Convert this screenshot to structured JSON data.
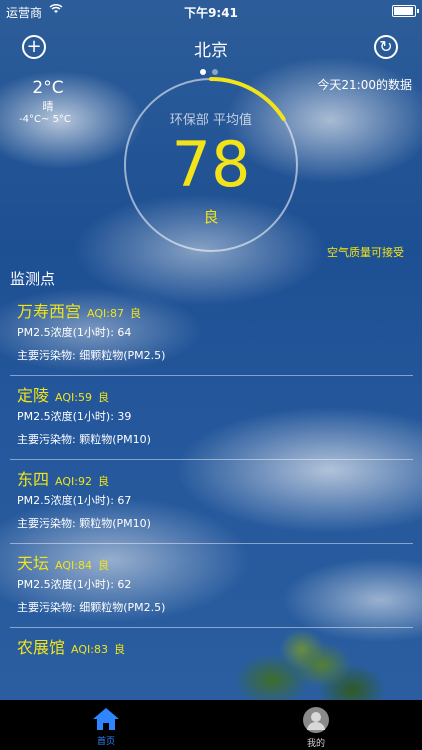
{
  "status_bar": {
    "carrier": "运营商",
    "time": "下午9:41",
    "battery_level": 0.95
  },
  "header": {
    "city": "北京",
    "page_count": 2,
    "active_page": 0,
    "add_icon": "plus-circle-icon",
    "refresh_icon": "refresh-icon"
  },
  "weather": {
    "temperature": "2°C",
    "condition": "晴",
    "range": "-4°C~ 5°C"
  },
  "data_time": "今天21:00的数据",
  "gauge": {
    "label": "环保部 平均值",
    "value": "78",
    "level": "良",
    "fill_fraction": 0.16
  },
  "quality_note": "空气质量可接受",
  "section_title": "监测点",
  "stations": [
    {
      "name": "万寿西宫",
      "aqi": "AQI:87",
      "level": "良",
      "pm25_label": "PM2.5浓度(1小时):",
      "pm25": "64",
      "pollutant_label": "主要污染物:",
      "pollutant": "细颗粒物(PM2.5)"
    },
    {
      "name": "定陵",
      "aqi": "AQI:59",
      "level": "良",
      "pm25_label": "PM2.5浓度(1小时):",
      "pm25": "39",
      "pollutant_label": "主要污染物:",
      "pollutant": "颗粒物(PM10)"
    },
    {
      "name": "东四",
      "aqi": "AQI:92",
      "level": "良",
      "pm25_label": "PM2.5浓度(1小时):",
      "pm25": "67",
      "pollutant_label": "主要污染物:",
      "pollutant": "颗粒物(PM10)"
    },
    {
      "name": "天坛",
      "aqi": "AQI:84",
      "level": "良",
      "pm25_label": "PM2.5浓度(1小时):",
      "pm25": "62",
      "pollutant_label": "主要污染物:",
      "pollutant": "细颗粒物(PM2.5)"
    },
    {
      "name": "农展馆",
      "aqi": "AQI:83",
      "level": "良"
    }
  ],
  "tab_bar": {
    "home_label": "首页",
    "me_label": "我的",
    "home_icon": "home-icon",
    "me_icon": "user-avatar-icon"
  },
  "colors": {
    "accent": "#f2e419",
    "tab_active": "#2e86ff"
  }
}
